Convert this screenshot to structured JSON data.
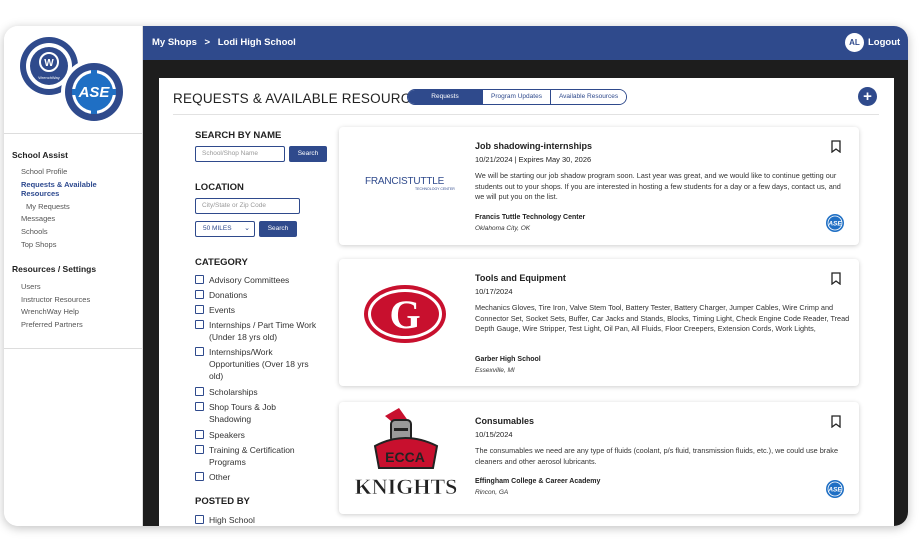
{
  "sidebar": {
    "groups": [
      {
        "label": "School Assist"
      },
      {
        "label": "Resources / Settings"
      }
    ],
    "school_assist_items": [
      {
        "label": "School Profile"
      },
      {
        "label": "Requests & Available Resources"
      },
      {
        "label": "My Requests"
      },
      {
        "label": "Messages"
      },
      {
        "label": "Schools"
      },
      {
        "label": "Top Shops"
      }
    ],
    "resources_items": [
      {
        "label": "Users"
      },
      {
        "label": "Instructor Resources"
      },
      {
        "label": "WrenchWay Help"
      },
      {
        "label": "Preferred Partners"
      }
    ],
    "logo_text": {
      "wrenchway": "WrenchWay",
      "ase": "ASE"
    }
  },
  "topbar": {
    "breadcrumb_root": "My Shops",
    "breadcrumb_separator": ">",
    "breadcrumb_current": "Lodi High School",
    "avatar_initials": "AL",
    "logout_label": "Logout"
  },
  "page": {
    "title": "REQUESTS & AVAILABLE RESOURCES",
    "tabs": [
      {
        "label": "Requests",
        "active": true
      },
      {
        "label": "Program Updates",
        "active": false
      },
      {
        "label": "Available Resources",
        "active": false
      }
    ],
    "add_icon": "plus-circle-icon"
  },
  "filters": {
    "search_by_name_label": "SEARCH BY NAME",
    "name_placeholder": "School/Shop Name",
    "search_button": "Search",
    "location_label": "LOCATION",
    "location_placeholder": "City/State or Zip Code",
    "miles_value": "50 MILES",
    "category_label": "CATEGORY",
    "categories": [
      "Advisory Committees",
      "Donations",
      "Events",
      "Internships / Part Time Work (Under 18 yrs old)",
      "Internships/Work Opportunities (Over 18 yrs old)",
      "Scholarships",
      "Shop Tours & Job Shadowing",
      "Speakers",
      "Training & Certification Programs",
      "Other"
    ],
    "posted_by_label": "POSTED BY",
    "posted_by": [
      "High School"
    ]
  },
  "cards": [
    {
      "title": "Job shadowing-internships",
      "date": "10/21/2024 | Expires May 30, 2026",
      "description": "We will be starting our job shadow program soon. Last year was great, and we would like to continue getting our students out to your shops. If you are interested in hosting a few students for a day or a few days, contact us, and we will put you on the list.",
      "org": "Francis Tuttle Technology Center",
      "location": "Oklahoma City, OK",
      "logo_text": "FRANCISTUTTLE",
      "logo_subtext": "TECHNOLOGY CENTER",
      "badge": "ASE"
    },
    {
      "title": "Tools and Equipment",
      "date": "10/17/2024",
      "description": "Mechanics Gloves, Tire Iron, Valve Stem Tool, Battery Tester, Battery Charger, Jumper Cables, Wire Crimp and Connector Set, Socket Sets, Buffer, Car Jacks and Stands, Blocks, Timing Light, Check Engine Code Reader, Tread Depth Gauge, Wire Stripper, Test Light, Oil Pan, All Fluids, Floor Creepers, Extension Cords, Work Lights,",
      "org": "Garber High School",
      "location": "Essexville, MI",
      "logo_text": "G",
      "badge": ""
    },
    {
      "title": "Consumables",
      "date": "10/15/2024",
      "description": "The consumables we need are any type of fluids (coolant, p/s fluid, transmission fluids, etc.), we could use brake cleaners and other aerosol lubricants.",
      "org": "Effingham College & Career Academy",
      "location": "Rincon, GA",
      "logo_text": "ECCA",
      "logo_subtext": "KNIGHTS",
      "badge": "ASE"
    }
  ],
  "colors": {
    "brand": "#2f4a8c",
    "topbar": "#2f4a8c",
    "ase_blue": "#1f6fc4",
    "garber_red": "#c8102e"
  }
}
